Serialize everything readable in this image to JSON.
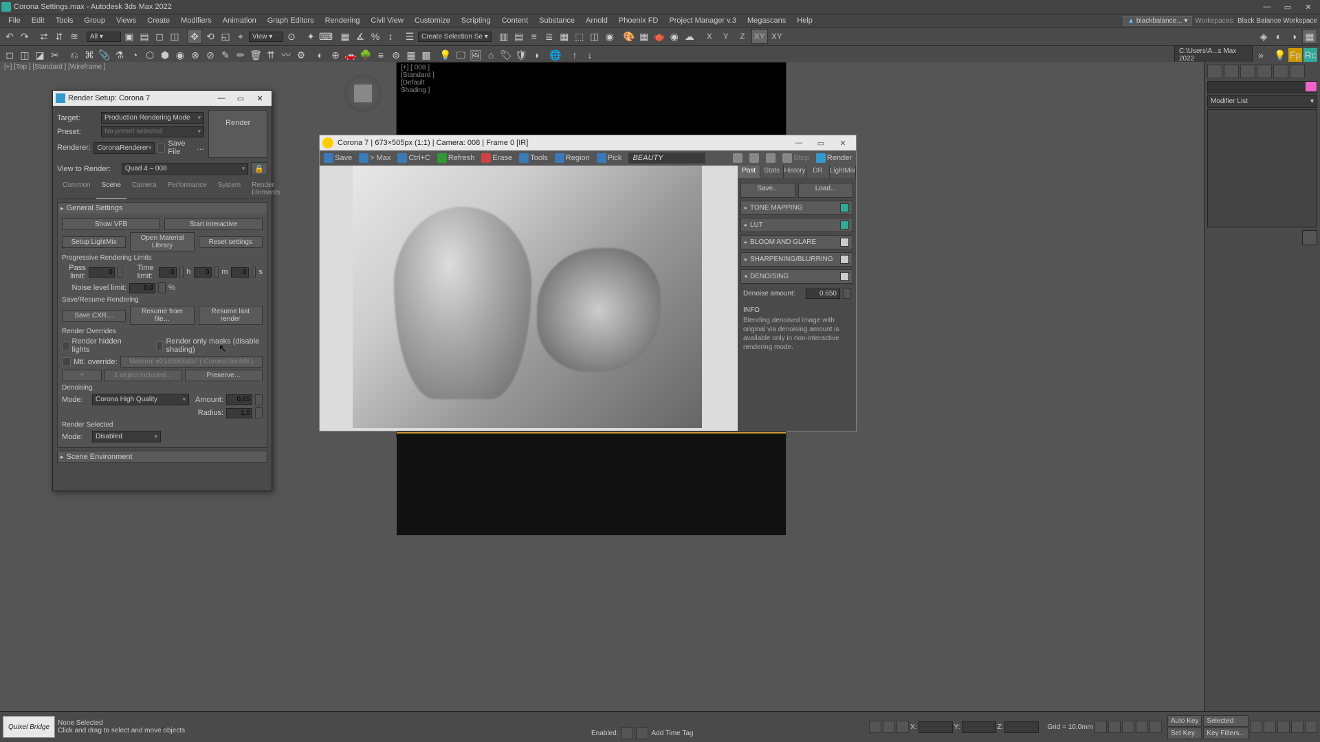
{
  "title": "Corona Settings.max - Autodesk 3ds Max 2022",
  "menus": [
    "File",
    "Edit",
    "Tools",
    "Group",
    "Views",
    "Create",
    "Modifiers",
    "Animation",
    "Graph Editors",
    "Rendering",
    "Civil View",
    "Customize",
    "Scripting",
    "Content",
    "Substance",
    "Arnold",
    "Phoenix FD",
    "Project Manager v.3",
    "Megascans",
    "Help"
  ],
  "signin": "blackbalance...",
  "ws_label": "Workspaces:",
  "ws_value": "Black Balance Workspace",
  "dd_all": "All",
  "dd_view": "View",
  "dd_create": "Create Selection Se",
  "path": "C:\\Users\\A...s Max 2022",
  "vp_label1": "[+] [Top ] [Standard ] [Wireframe ]",
  "vp_label2": "[+] [ 008 ] [Standard ] [Default Shading ]",
  "dlg": {
    "title": "Render Setup: Corona 7",
    "target_l": "Target:",
    "target_v": "Production Rendering Mode",
    "preset_l": "Preset:",
    "preset_v": "No preset selected",
    "renderer_l": "Renderer:",
    "renderer_v": "CoronaRenderer",
    "savefile": "Save File",
    "render": "Render",
    "view_l": "View to Render:",
    "view_v": "Quad 4 – 008",
    "tabs": [
      "Common",
      "Scene",
      "Camera",
      "Performance",
      "System",
      "Render Elements"
    ],
    "roll1": "General Settings",
    "showvfb": "Show VFB",
    "startint": "Start interactive",
    "setuplm": "Setup LightMix",
    "openml": "Open Material Library",
    "resetset": "Reset settings",
    "progh": "Progressive Rendering Limits",
    "passl": "Pass limit:",
    "passv": "0",
    "timel": "Time limit:",
    "tv0": "0",
    "th": "h",
    "tv1": "0",
    "tm": "m",
    "tv2": "0",
    "ts": "s",
    "noisel": "Noise level limit:",
    "noisev": "0,0",
    "pct": "%",
    "srh": "Save/Resume Rendering",
    "savecxr": "Save CXR…",
    "resfile": "Resume from file…",
    "reslast": "Resume last render",
    "roh": "Render Overrides",
    "rhl": "Render hidden lights",
    "rom": "Render only masks (disable shading)",
    "mtlo": "Mtl. override:",
    "mtlv": "Material #2145966497  ( CoronaSkinMtl )",
    "objinc": "1 object included…",
    "preserve": "Preserve…",
    "denh": "Denoising",
    "model": "Mode:",
    "modev": "Corona High Quality",
    "amtl": "Amount:",
    "amtv": "0,65",
    "radl": "Radius:",
    "radv": "1,0",
    "rsh": "Render Selected",
    "rsmodel": "Mode:",
    "rsmodev": "Disabled",
    "roll2": "Scene Environment"
  },
  "vfb": {
    "title": "Corona 7 | 673×505px (1:1) | Camera: 008 | Frame 0 [IR]",
    "save": "Save",
    "tomax": "> Max",
    "ctrlc": "Ctrl+C",
    "refresh": "Refresh",
    "erase": "Erase",
    "tools": "Tools",
    "region": "Region",
    "pick": "Pick",
    "pass": "BEAUTY",
    "stop": "Stop",
    "render": "Render",
    "stabs": [
      "Post",
      "Stats",
      "History",
      "DR",
      "LightMix"
    ],
    "savebtn": "Save...",
    "loadbtn": "Load...",
    "tm": "TONE MAPPING",
    "lut": "LUT",
    "bloom": "BLOOM AND GLARE",
    "sharp": "SHARPENING/BLURRING",
    "denoise": "DENOISING",
    "damtl": "Denoise amount:",
    "damtv": "0.650",
    "infoh": "INFO",
    "infot": "Blending denoised image with original via denoising amount is available only in non-interactive rendering mode."
  },
  "rpanel": {
    "ml": "Modifier List"
  },
  "status": {
    "qx": "Quixel Bridge",
    "none": "None Selected",
    "hint": "Click and drag to select and move objects",
    "grid": "Grid = 10,0mm",
    "xl": "X:",
    "yl": "Y:",
    "zl": "Z:",
    "enabled": "Enabled:",
    "addtag": "Add Time Tag",
    "autokey": "Auto Key",
    "setkey": "Set Key",
    "selected": "Selected",
    "keyfilt": "Key Filters..."
  }
}
